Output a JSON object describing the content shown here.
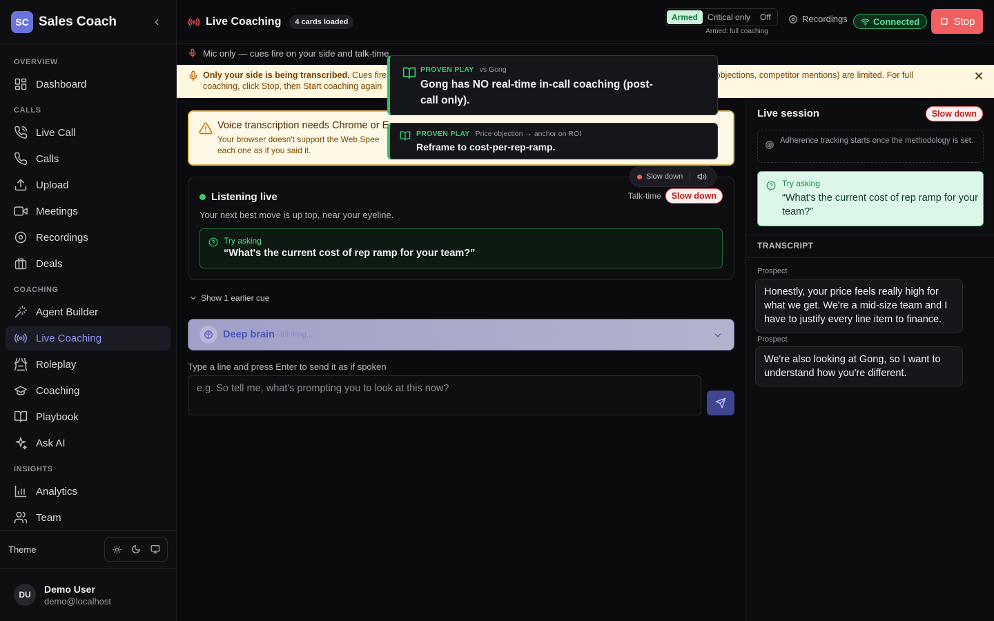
{
  "sidebar": {
    "logo": "SC",
    "brand": "Sales Coach",
    "sections": {
      "overview": "OVERVIEW",
      "calls": "CALLS",
      "coaching": "COACHING",
      "insights": "INSIGHTS"
    },
    "items": {
      "dashboard": "Dashboard",
      "live_call": "Live Call",
      "calls": "Calls",
      "upload": "Upload",
      "meetings": "Meetings",
      "recordings": "Recordings",
      "deals": "Deals",
      "agent_builder": "Agent Builder",
      "live_coaching": "Live Coaching",
      "roleplay": "Roleplay",
      "coaching": "Coaching",
      "playbook": "Playbook",
      "ask_ai": "Ask AI",
      "analytics": "Analytics",
      "team": "Team"
    },
    "theme_label": "Theme",
    "user": {
      "initials": "DU",
      "name": "Demo User",
      "email": "demo@localhost"
    }
  },
  "topbar": {
    "title": "Live Coaching",
    "cards_badge": "4 cards loaded",
    "modes": [
      "Armed",
      "Critical only",
      "Off"
    ],
    "mode_note": "Armed: full coaching",
    "recordings": "Recordings",
    "connection": "Connected",
    "stop": "Stop"
  },
  "mic_notice": "Mic only — cues fire on your side and talk-time.",
  "banner": {
    "bold": "Only your side is being transcribed.",
    "rest": " Cues fire on your side and talk-time; prospect-triggered cues (objections, competitor mentions) are limited. For full coaching, click Stop, then Start coaching again",
    "line1_prefix": "Cues fire c",
    "line1_suffix": "es (objections, competitor mentions) are limited. For full",
    "line2": "coaching, click Stop, then Start coaching again"
  },
  "voice": {
    "title": "Voice transcription needs Chrome or Edge",
    "title_visible": "Voice transcription needs Chrome or E",
    "desc_line1": "Your browser doesn't support the Web Spee",
    "desc_line2": "each one as if you said it."
  },
  "plays": [
    {
      "tag": "PROVEN PLAY",
      "context": "vs Gong",
      "text": "Gong has NO real-time in-call coaching (post-call only)."
    },
    {
      "tag": "PROVEN PLAY",
      "context": "Price objection → anchor on ROI",
      "text": "Reframe to cost-per-rep-ramp."
    }
  ],
  "floater": {
    "label": "Slow down"
  },
  "listening": {
    "title": "Listening live",
    "talk_label": "Talk-time",
    "talk_status": "Slow down",
    "subtitle": "Your next best move is up top, near your eyeline.",
    "ask_label": "Try asking",
    "ask_question": "“What's the current cost of rep ramp for your team?”"
  },
  "earlier_cue": "Show 1 earlier cue",
  "deep_brain": {
    "title": "Deep brain",
    "state": "thinking..."
  },
  "type_line": {
    "label": "Type a line and press Enter to send it as if spoken",
    "placeholder": "e.g. So tell me, what's prompting you to look at this now?"
  },
  "right_panel": {
    "title": "Live session",
    "status": "Slow down",
    "adherence": "Adherence tracking starts once the methodology is set.",
    "ask_label": "Try asking",
    "ask_question": "“What's the current cost of rep ramp for your team?”",
    "transcript_title": "TRANSCRIPT",
    "messages": [
      {
        "role": "Prospect",
        "text": "Honestly, your price feels really high for what we get. We're a mid-size team and I have to justify every line item to finance."
      },
      {
        "role": "Prospect",
        "text": "We're also looking at Gong, so I want to understand how you're different."
      }
    ]
  },
  "colors": {
    "accent": "#8f95f0",
    "success": "#3ccb6f",
    "danger": "#f06060",
    "warning_bg": "#fff7e0"
  }
}
